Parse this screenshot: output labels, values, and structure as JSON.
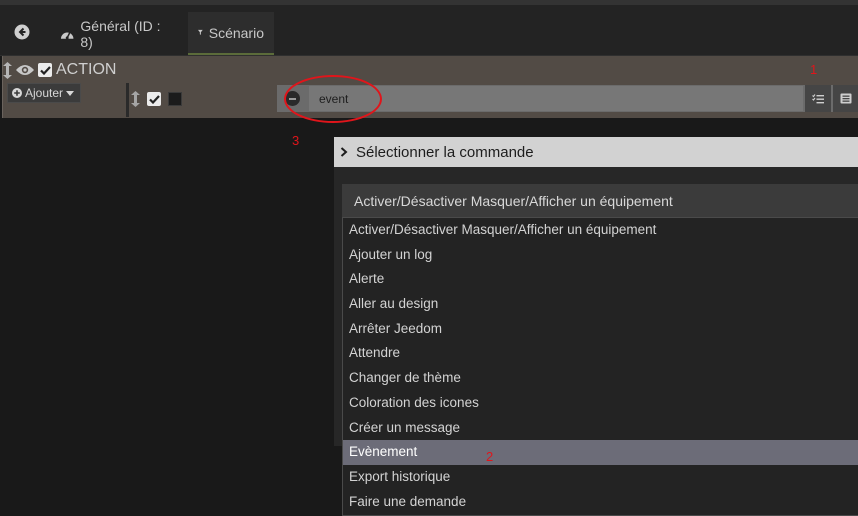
{
  "tabs": {
    "general_label": "Général (ID : 8)",
    "scenario_label": "Scénario"
  },
  "action_block": {
    "title": "ACTION",
    "add_label": "Ajouter",
    "command_value": "event"
  },
  "annotations": {
    "marker_1": "1",
    "marker_2": "2",
    "marker_3": "3"
  },
  "dialog": {
    "title": "Sélectionner la commande",
    "selected_value": "Activer/Désactiver Masquer/Afficher un équipement",
    "options": [
      "Activer/Désactiver Masquer/Afficher un équipement",
      "Ajouter un log",
      "Alerte",
      "Aller au design",
      "Arrêter Jeedom",
      "Attendre",
      "Changer de thème",
      "Coloration des icones",
      "Créer un message",
      "Evènement",
      "Export historique",
      "Faire une demande"
    ],
    "highlighted_option": "Evènement"
  },
  "colors": {
    "background": "#191919",
    "action_block": "#524b45",
    "annotation_red": "#e0151b",
    "highlight": "#6c6c78"
  }
}
